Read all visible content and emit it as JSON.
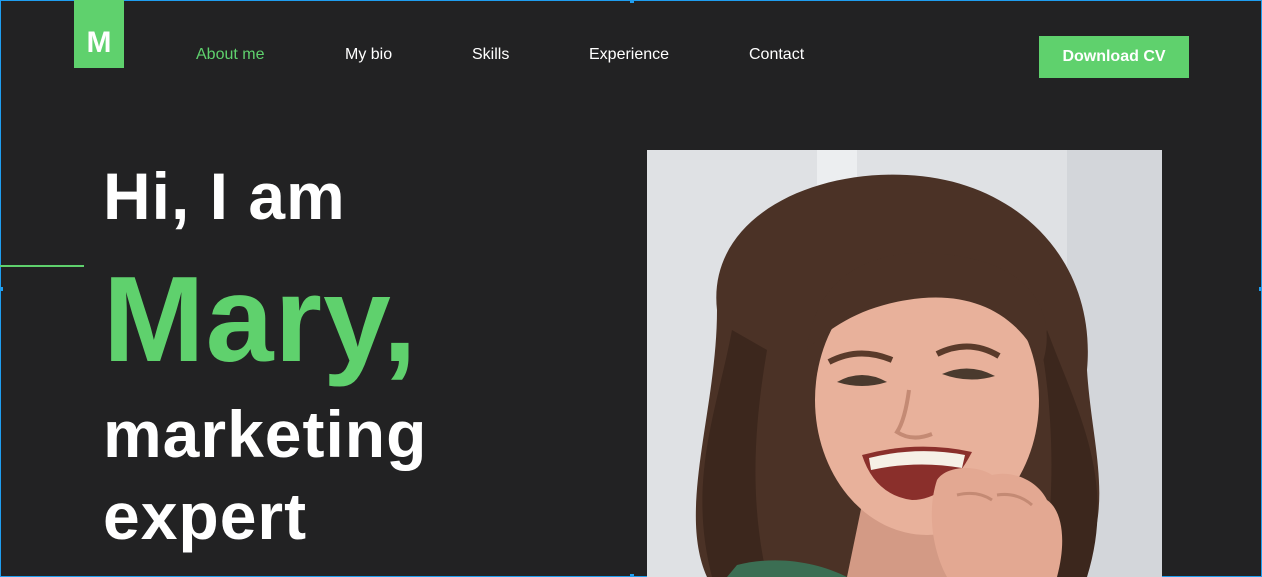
{
  "brand": {
    "logo_letter": "M",
    "accent_color": "#5fd16d"
  },
  "nav": {
    "items": [
      {
        "label": "About me",
        "active": true
      },
      {
        "label": "My bio",
        "active": false
      },
      {
        "label": "Skills",
        "active": false
      },
      {
        "label": "Experience",
        "active": false
      },
      {
        "label": "Contact",
        "active": false
      }
    ]
  },
  "header": {
    "download_label": "Download CV"
  },
  "hero": {
    "greeting": "Hi, I am",
    "name": "Mary,",
    "role_line1": "marketing",
    "role_line2": "expert"
  },
  "photo": {
    "subject": "smiling woman portrait"
  }
}
